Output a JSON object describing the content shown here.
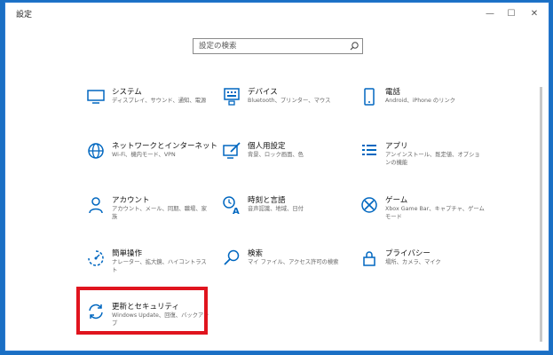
{
  "window": {
    "title": "設定",
    "controls": {
      "minimize": "—",
      "maximize": "☐",
      "close": "✕"
    }
  },
  "search": {
    "placeholder": "設定の検索",
    "icon": "search-icon"
  },
  "colors": {
    "accent": "#0067c0",
    "highlight_border": "#e0141e",
    "desktop_background": "#1a6fc4"
  },
  "categories": [
    {
      "label": "システム",
      "description": "ディスプレイ、サウンド、通知、電源",
      "icon": "monitor-icon"
    },
    {
      "label": "デバイス",
      "description": "Bluetooth、プリンター、マウス",
      "icon": "keyboard-icon"
    },
    {
      "label": "電話",
      "description": "Android、iPhone のリンク",
      "icon": "phone-icon"
    },
    {
      "label": "ネットワークとインターネット",
      "description": "Wi-Fi、機内モード、VPN",
      "icon": "globe-icon"
    },
    {
      "label": "個人用設定",
      "description": "背景、ロック画面、色",
      "icon": "personalization-icon"
    },
    {
      "label": "アプリ",
      "description": "アンインストール、既定値、オプションの機能",
      "icon": "apps-list-icon"
    },
    {
      "label": "アカウント",
      "description": "アカウント、メール、同期、職場、家族",
      "icon": "person-icon"
    },
    {
      "label": "時刻と言語",
      "description": "音声認識、地域、日付",
      "icon": "time-language-icon"
    },
    {
      "label": "ゲーム",
      "description": "Xbox Game Bar、キャプチャ、ゲーム モード",
      "icon": "xbox-icon"
    },
    {
      "label": "簡単操作",
      "description": "ナレーター、拡大鏡、ハイコントラスト",
      "icon": "ease-of-access-icon"
    },
    {
      "label": "検索",
      "description": "マイ ファイル、アクセス許可の検索",
      "icon": "search-icon"
    },
    {
      "label": "プライバシー",
      "description": "場所、カメラ、マイク",
      "icon": "lock-icon"
    },
    {
      "label": "更新とセキュリティ",
      "description": "Windows Update、回復、バックアップ",
      "icon": "update-icon"
    }
  ]
}
